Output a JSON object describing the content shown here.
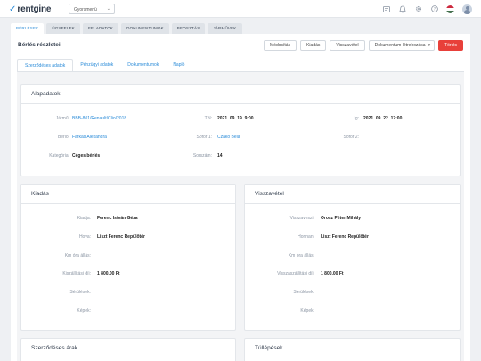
{
  "app": {
    "logo_text": "rentgine",
    "logo_mark": "✓"
  },
  "menu_dropdown": {
    "label": "Gyorsmenü"
  },
  "top_icons": [
    "id-card-icon",
    "bell-icon",
    "gear-icon",
    "help-icon",
    "hungarian-flag-icon",
    "avatar"
  ],
  "flag_colors": [
    "#cd2a3e",
    "#ffffff",
    "#436f4d"
  ],
  "nav_tabs": [
    {
      "label": "Bérlések",
      "active": true
    },
    {
      "label": "Ügyfelek"
    },
    {
      "label": "Feladatok"
    },
    {
      "label": "Dokumentumok"
    },
    {
      "label": "Beosztás"
    },
    {
      "label": "Járművek"
    }
  ],
  "page": {
    "title": "Bérlés részletei",
    "actions": {
      "modify": "Módosítás",
      "handover": "Kiadás",
      "return": "Visszavétel",
      "create_document": "Dokumentum létrehozása",
      "delete": "Törlés"
    }
  },
  "sub_tabs": [
    {
      "label": "Szerződéses adatok",
      "active": true
    },
    {
      "label": "Pénzügyi adatok"
    },
    {
      "label": "Dokumentumok"
    },
    {
      "label": "Napló"
    }
  ],
  "basics": {
    "title": "Alapadatok",
    "vehicle_label": "Jármű:",
    "vehicle_value": "BBB-801/Renault/Clio/2018",
    "from_label": "Tól:",
    "from_value": "2021. 09. 19. 9:00",
    "to_label": "Ig:",
    "to_value": "2021. 09. 22. 17:00",
    "renter_label": "Bérlő:",
    "renter_value": "Farkas Alexandra",
    "driver1_label": "Sofőr 1:",
    "driver1_value": "Czakó Béla",
    "driver2_label": "Sofőr 2:",
    "driver2_value": "",
    "category_label": "Kategória:",
    "category_value": "Céges bérlés",
    "serial_label": "Sorszám:",
    "serial_value": "14"
  },
  "handover": {
    "title": "Kiadás",
    "issuer_label": "Kiadja:",
    "issuer_value": "Ferenc István Géza",
    "where_label": "Hova:",
    "where_value": "Liszt Ferenc Repülőtér",
    "km_label": "Km óra állás:",
    "km_value": "",
    "fee_label": "Kiszállítási díj:",
    "fee_value": "1 800,00 Ft",
    "damage_label": "Sérülések:",
    "damage_value": "",
    "images_label": "Képek:",
    "images_value": ""
  },
  "return": {
    "title": "Visszavétel",
    "receiver_label": "Visszaveszi:",
    "receiver_value": "Orosz Péter Mihály",
    "from_label": "Honnan:",
    "from_value": "Liszt Ferenc Repülőtér",
    "km_label": "Km óra állás:",
    "km_value": "",
    "fee_label": "Visszaszállítási díj:",
    "fee_value": "1 800,00 Ft",
    "damage_label": "Sérülések:",
    "damage_value": "",
    "images_label": "Képek:",
    "images_value": ""
  },
  "contract_prices": {
    "title": "Szerződéses árak"
  },
  "overruns": {
    "title": "Túllépések"
  },
  "colors": {
    "accent": "#2a8bd8",
    "danger": "#e8403a",
    "background": "#eef0f3"
  }
}
